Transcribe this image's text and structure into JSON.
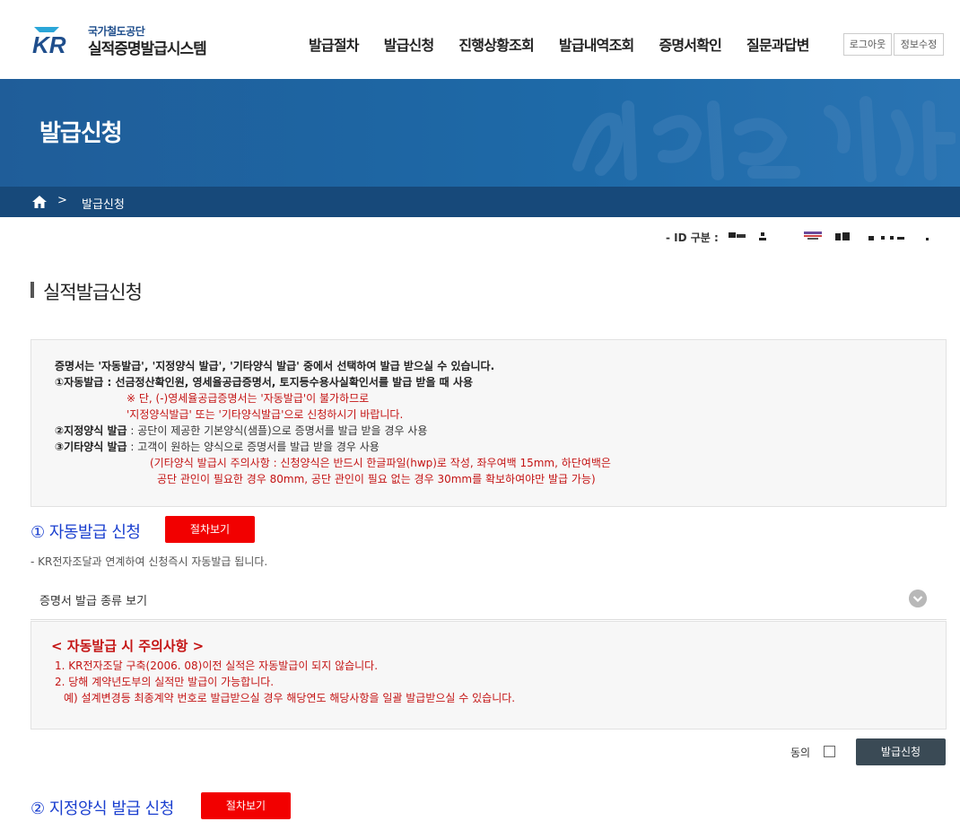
{
  "header": {
    "org_name": "국가철도공단",
    "system_name": "실적증명발급시스템",
    "nav": [
      "발급절차",
      "발급신청",
      "진행상황조회",
      "발급내역조회",
      "증명서확인",
      "질문과답변"
    ],
    "logout": "로그아웃",
    "edit_info": "정보수정"
  },
  "banner": {
    "title": "발급신청",
    "breadcrumb_current": "발급신청",
    "breadcrumb_sep": ">"
  },
  "user": {
    "id_label": "- ID 구분 :"
  },
  "page_title": "실적발급신청",
  "info": {
    "l1": "증명서는 '자동발급', '지정양식 발급', '기타양식 발급' 중에서 선택하여 발급 받으실 수 있습니다.",
    "l2": "①자동발급 : 선금정산확인원, 영세율공급증명서, 토지등수용사실확인서를 발급 받을 때 사용",
    "l3": "※ 단, (-)영세율공급증명서는 '자동발급'이 불가하므로",
    "l4": "'지정양식발급' 또는 '기타양식발급'으로 신청하시기 바랍니다.",
    "l5_bold": "②지정양식 발급",
    "l5_rest": " : 공단이 제공한 기본양식(샘플)으로 증명서를 발급 받을 경우 사용",
    "l6_bold": "③기타양식 발급",
    "l6_rest": " : 고객이 원하는 양식으로 증명서를 발급 받을 경우 사용",
    "l7": "(기타양식 발급시 주의사항 : 신청양식은 반드시 한글파일(hwp)로 작성, 좌우여백 15mm, 하단여백은",
    "l8": "공단 관인이 필요한 경우 80mm, 공단 관인이 필요 없는 경우 30mm를 확보하여야만 발급 가능)"
  },
  "auto": {
    "title": "① 자동발급 신청",
    "proc_button": "절차보기",
    "desc": "- KR전자조달과 연계하여 신청즉시 자동발급 됩니다.",
    "accordion_label": "증명서 발급 종류 보기",
    "warn_title": "< 자동발급 시 주의사항 >",
    "warn1": "1. KR전자조달 구축(2006. 08)이전 실적은 자동발급이 되지 않습니다.",
    "warn2": "2. 당해 계약년도부의 실적만 발급이 가능합니다.",
    "warn3": "예) 설계변경등 최종계약 번호로 발급받으실 경우 해당연도 해당사항을 일괄 발급받으실 수 있습니다.",
    "agree_label": "동의",
    "apply_button": "발급신청"
  },
  "designated": {
    "title": "② 지정양식 발급 신청",
    "proc_button": "절차보기"
  },
  "colors": {
    "banner": "#1e6aa8",
    "breadcrumb_bar": "#17497a",
    "red_button": "#f20000",
    "subtitle_blue": "#1a3fcf",
    "warning_red": "#c41414",
    "dark_button": "#3a4a55"
  }
}
